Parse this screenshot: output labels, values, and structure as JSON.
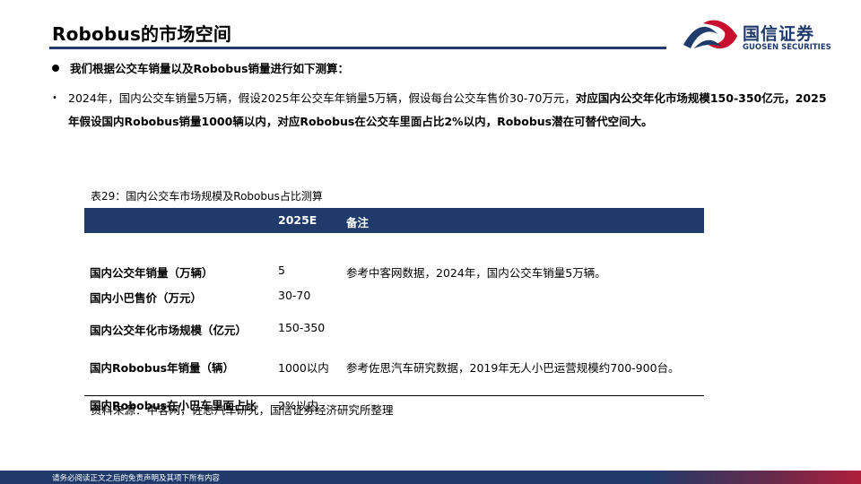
{
  "header": {
    "title": "Robobus的市场空间",
    "logo_cn": "国信证券",
    "logo_en": "GUOSEN SECURITIES",
    "brand_color": "#1f3a6b",
    "accent_color": "#c8102e"
  },
  "bullet1": "我们根据公交车销量以及Robobus销量进行如下测算：",
  "para": {
    "mark": "•",
    "plain": "2024年，国内公交车销量5万辆，假设2025年公交车年销量5万辆，假设每台公交车售价30-70万元，",
    "bold": "对应国内公交年化市场规模150-350亿元，2025年假设国内Robobus销量1000辆以内，对应Robobus在公交车里面占比2%以内，Robobus潜在可替代空间大。"
  },
  "table": {
    "caption": "表29：国内公交车市场规模及Robobus占比测算",
    "headers": [
      "",
      "2025E",
      "备注"
    ],
    "rows": [
      {
        "item": "国内公交年销量（万辆）",
        "value": "5",
        "note": "参考中客网数据，2024年，国内公交车销量5万辆。"
      },
      {
        "item": "国内小巴售价（万元）",
        "value": "30-70",
        "note": ""
      },
      {
        "item": "国内公交年化市场规模（亿元）",
        "value": "150-350",
        "note": ""
      },
      {
        "item": "国内Robobus年销量（辆）",
        "value": "1000以内",
        "note": "参考佐思汽车研究数据，2019年无人小巴运营规模约700-900台。"
      },
      {
        "item": "国内Robobus在小巴车里面占比",
        "value": "2%以内",
        "note": ""
      }
    ],
    "source": "资料来源：中客网，佐思汽车研究，国信证券经济研究所整理"
  },
  "footer": "请务必阅读正文之后的免责声明及其项下所有内容"
}
